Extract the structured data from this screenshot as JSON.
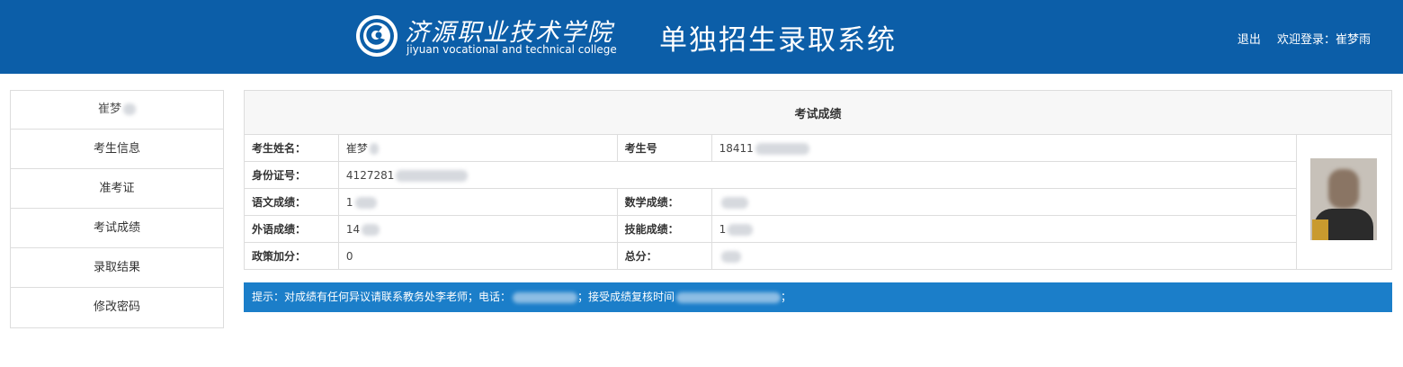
{
  "header": {
    "school_name_cn": "济源职业技术学院",
    "school_name_en": "jiyuan vocational and technical college",
    "system_title": "单独招生录取系统",
    "logout_label": "退出",
    "welcome_label": "欢迎登录：崔梦雨",
    "logo_icon": "college-logo-icon",
    "brand_color": "#0c5ea8"
  },
  "sidebar": {
    "student_name": "崔梦",
    "items": [
      {
        "label": "考生信息"
      },
      {
        "label": "准考证"
      },
      {
        "label": "考试成绩"
      },
      {
        "label": "录取结果"
      },
      {
        "label": "修改密码"
      }
    ]
  },
  "scores": {
    "caption": "考试成绩",
    "name_label": "考生姓名：",
    "name_value": "崔梦",
    "exam_no_label": "考生号",
    "exam_no_value": "18411",
    "id_label": "身份证号：",
    "id_value": "4127281",
    "chinese_label": "语文成绩：",
    "chinese_value": "1",
    "math_label": "数学成绩：",
    "math_value": "",
    "english_label": "外语成绩：",
    "english_value": "14",
    "skill_label": "技能成绩：",
    "skill_value": "1",
    "policy_label": "政策加分：",
    "policy_value": "0",
    "total_label": "总分：",
    "total_value": ""
  },
  "notice": {
    "text_prefix": "提示：对成绩有任何异议请联系教务处李老师；电话：",
    "text_middle": "；接受成绩复核时间",
    "text_suffix": "；",
    "background_color": "#1b7ec9"
  }
}
